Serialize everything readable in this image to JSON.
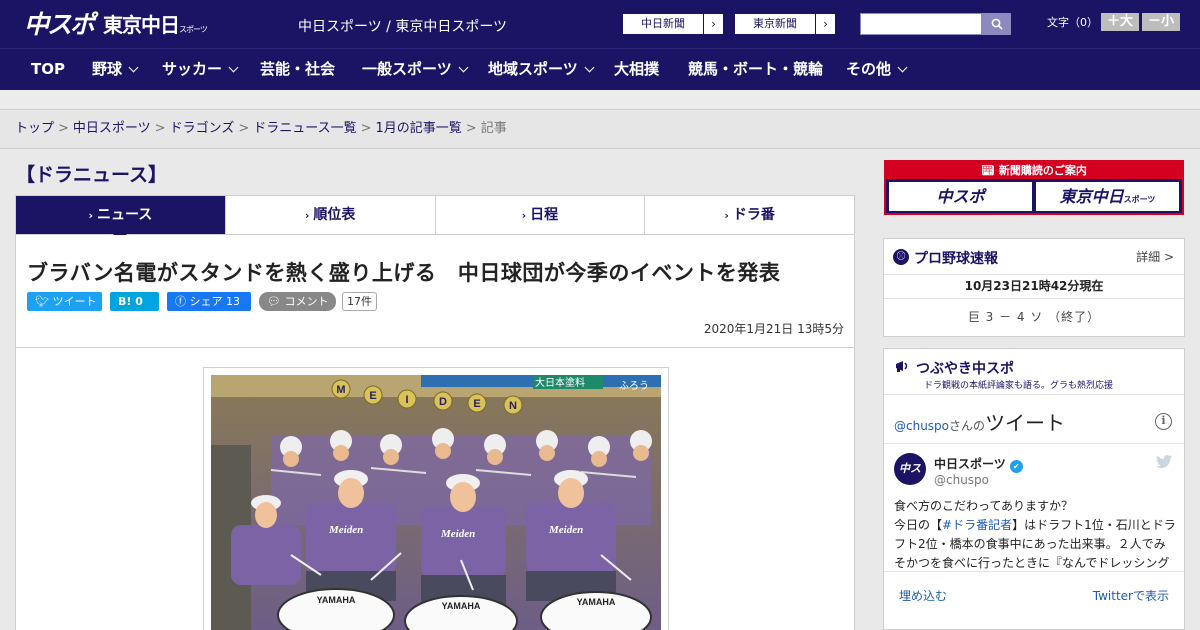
{
  "header": {
    "logo_main": "中スポ",
    "logo_sub": "東京中日",
    "logo_sub_small": "スポーツ",
    "site_title": "中日スポーツ / 東京中日スポーツ",
    "ext_links": [
      "中日新聞",
      "東京新聞"
    ],
    "search_placeholder": "",
    "font_size_label": "文字（0）",
    "font_up": "＋大",
    "font_down": "－小"
  },
  "nav": {
    "items": [
      {
        "label": "TOP",
        "dropdown": false
      },
      {
        "label": "野球",
        "dropdown": true
      },
      {
        "label": "サッカー",
        "dropdown": true
      },
      {
        "label": "芸能・社会",
        "dropdown": false
      },
      {
        "label": "一般スポーツ",
        "dropdown": true
      },
      {
        "label": "地域スポーツ",
        "dropdown": true
      },
      {
        "label": "大相撲",
        "dropdown": false
      },
      {
        "label": "競馬・ボート・競輪",
        "dropdown": false
      },
      {
        "label": "その他",
        "dropdown": true
      }
    ]
  },
  "breadcrumb": {
    "items": [
      "トップ",
      "中日スポーツ",
      "ドラゴンズ",
      "ドラニュース一覧",
      "1月の記事一覧"
    ],
    "current": "記事",
    "separator": ">"
  },
  "section_title": "【ドラニュース】",
  "tabs": [
    {
      "label": "ニュース",
      "active": true
    },
    {
      "label": "順位表",
      "active": false
    },
    {
      "label": "日程",
      "active": false
    },
    {
      "label": "ドラ番",
      "active": false
    }
  ],
  "article": {
    "headline": "ブラバン名電がスタンドを熱く盛り上げる　中日球団が今季のイベントを発表",
    "share": {
      "tweet": "ツイート",
      "hatena": "B! 0",
      "facebook": "シェア 13",
      "comment": "コメント",
      "comment_count": "17件"
    },
    "date": "2020年1月21日 13時5分"
  },
  "photo": {
    "banner_text": "大日本塗料",
    "banner_text2": "ふろう",
    "letters": [
      "M",
      "E",
      "I",
      "D",
      "E",
      "N"
    ],
    "shirt_text": "Meiden",
    "drum_text": "YAMAHA"
  },
  "sidebar": {
    "ad": {
      "title": "新聞購読のご案内",
      "cells": [
        "中スポ",
        "東京中日"
      ],
      "cell_small": "スポーツ"
    },
    "baseball": {
      "title": "プロ野球速報",
      "more": "詳細 >",
      "timestamp": "10月23日21時42分現在",
      "score": "巨 3 － 4 ソ （終了）"
    },
    "tweets": {
      "title": "つぶやき中スポ",
      "subtitle": "ドラ観戦の本紙評論家も語る。グラも熱烈応援",
      "handle_link": "@chuspo",
      "san": "さんの",
      "tweet_word": "ツイート",
      "account_name": "中日スポーツ",
      "account_handle": "@chuspo",
      "avatar_text": "中スポ",
      "body_lines": [
        "食べ方のこだわってありますか？",
        "今日の【#ドラ番記者】はドラフト1位・石川とドラ",
        "フト2位・橋本の食事中にあった出来事。２人でみ",
        "そかつを食べに行ったときに『なんでドレッシング"
      ],
      "embed": "埋め込む",
      "view_on_twitter": "Twitterで表示"
    }
  },
  "colors": {
    "brand_navy": "#1b1464",
    "ad_red": "#d3001f",
    "twitter_blue": "#1da1f2",
    "facebook_blue": "#1877f2"
  }
}
